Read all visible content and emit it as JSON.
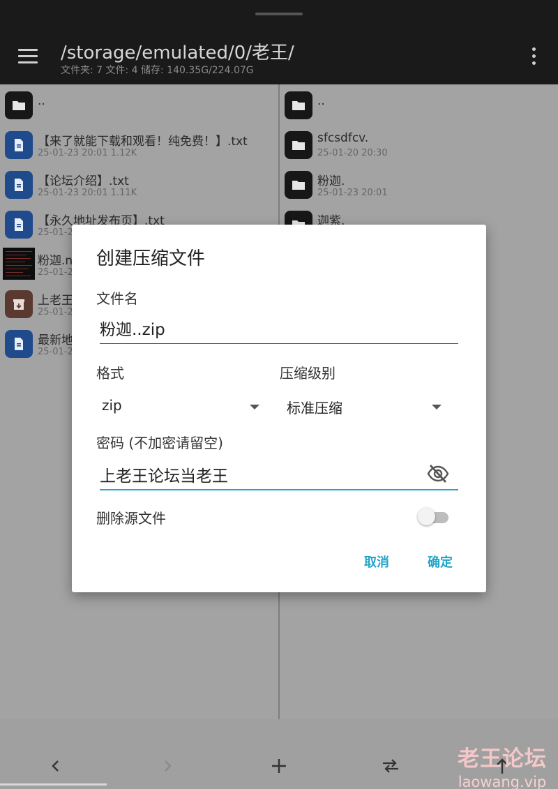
{
  "topbar": {
    "path": "/storage/emulated/0/老王/",
    "stats": "文件夹: 7  文件: 4  储存: 140.35G/224.07G"
  },
  "left_pane": {
    "items": [
      {
        "name": "..",
        "meta": "",
        "icon": "folder-icon"
      },
      {
        "name": "【来了就能下载和观看！纯免费！】.txt",
        "meta": "25-01-23 20:01  1.12K",
        "icon": "document-icon"
      },
      {
        "name": "【论坛介绍】.txt",
        "meta": "25-01-23 20:01  1.11K",
        "icon": "document-icon"
      },
      {
        "name": "【永久地址发布页】.txt",
        "meta": "25-01-2",
        "icon": "document-icon"
      },
      {
        "name": "粉迦.n",
        "meta": "25-01-2",
        "icon": "image-thumbnail"
      },
      {
        "name": "上老王",
        "meta": "25-01-2",
        "icon": "archive-icon"
      },
      {
        "name": "最新地",
        "meta": "25-01-2",
        "icon": "document-icon"
      }
    ]
  },
  "right_pane": {
    "items": [
      {
        "name": "..",
        "meta": "",
        "icon": "folder-icon"
      },
      {
        "name": "sfcsdfcv.",
        "meta": "25-01-20 20:30",
        "icon": "folder-icon"
      },
      {
        "name": "粉迦.",
        "meta": "25-01-23 20:01",
        "icon": "folder-icon"
      },
      {
        "name": "迦紫.",
        "meta": "",
        "icon": "folder-icon"
      }
    ]
  },
  "dialog": {
    "title": "创建压缩文件",
    "filename_label": "文件名",
    "filename_value": "粉迦..zip",
    "format_label": "格式",
    "format_value": "zip",
    "level_label": "压缩级别",
    "level_value": "标准压缩",
    "password_label": "密码 (不加密请留空)",
    "password_value": "上老王论坛当老王",
    "delete_source_label": "删除源文件",
    "delete_source_on": false,
    "cancel_label": "取消",
    "ok_label": "确定"
  },
  "bottombar": {
    "buttons": [
      "back-icon",
      "forward-icon",
      "add-icon",
      "swap-icon",
      "up-icon"
    ]
  },
  "watermark": {
    "cn": "老王论坛",
    "en": "laowang.vip"
  },
  "colors": {
    "accent": "#1fa5c9",
    "topbar_bg": "#1a1a1a",
    "doc_icon": "#1f4b8c"
  }
}
